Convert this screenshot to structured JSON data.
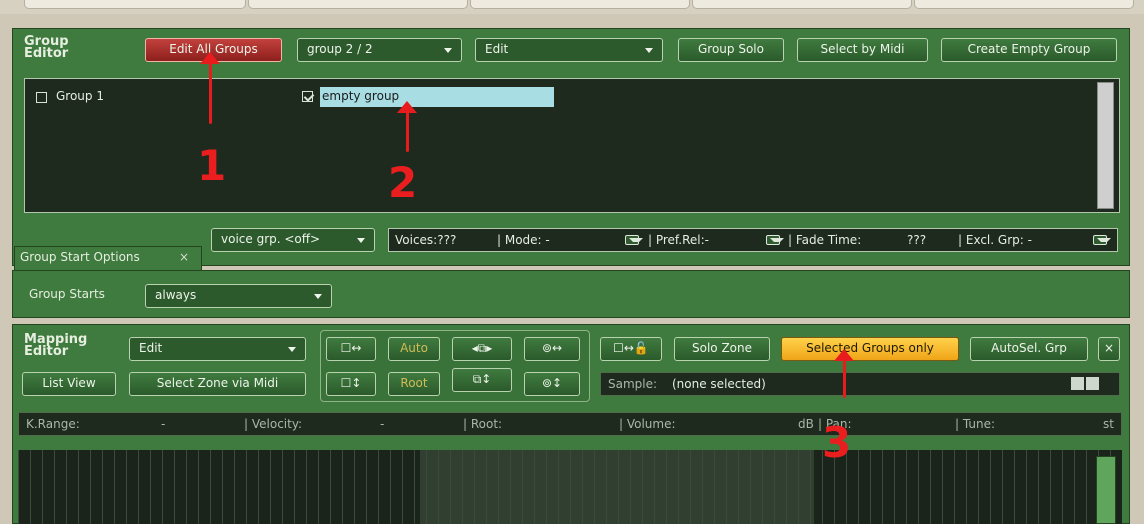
{
  "group_editor": {
    "title_line1": "Group",
    "title_line2": "Editor",
    "edit_all_groups": "Edit All Groups",
    "group_select": "group 2 / 2",
    "edit_menu": "Edit",
    "group_solo": "Group Solo",
    "select_by_midi": "Select by Midi",
    "create_empty_group": "Create Empty Group",
    "groups": [
      {
        "label": "Group 1",
        "checked": false
      },
      {
        "label": "empty group",
        "checked": true
      }
    ]
  },
  "voice_bar": {
    "voice_group": "voice grp. <off>",
    "voices": "Voices:???",
    "mode": "| Mode: -",
    "pref_rel": "| Pref.Rel:-",
    "fade_time_label": "| Fade Time:",
    "fade_time_value": "???",
    "excl_grp": "| Excl. Grp: -"
  },
  "group_start_tab": {
    "label": "Group Start Options",
    "close": "×",
    "group_starts_label": "Group Starts",
    "group_starts_value": "always"
  },
  "mapping_editor": {
    "title_line1": "Mapping",
    "title_line2": "Editor",
    "edit_menu": "Edit",
    "list_view": "List View",
    "select_zone_via_midi": "Select Zone via Midi",
    "auto": "Auto",
    "root": "Root",
    "solo_zone": "Solo Zone",
    "selected_groups_only": "Selected Groups only",
    "autosel_grp": "AutoSel. Grp",
    "close": "×",
    "sample_label": "Sample:",
    "sample_value": "(none selected)"
  },
  "info_row": {
    "krange_label": "K.Range:",
    "krange_value": "-",
    "velocity_label": "| Velocity:",
    "velocity_value": "-",
    "root_label": "| Root:",
    "volume_label": "| Volume:",
    "volume_unit": "dB",
    "pan_label": "| Pan:",
    "tune_label": "| Tune:",
    "tune_unit": "st"
  },
  "annotations": [
    "1",
    "2",
    "3"
  ],
  "colors": {
    "panel": "#3f7a3f",
    "panel_dark": "#1d2a1d",
    "highlight_input": "#a7dde3",
    "red_button": "#b73430",
    "yellow_button": "#f9c03a",
    "annotation": "#e81c1c"
  }
}
